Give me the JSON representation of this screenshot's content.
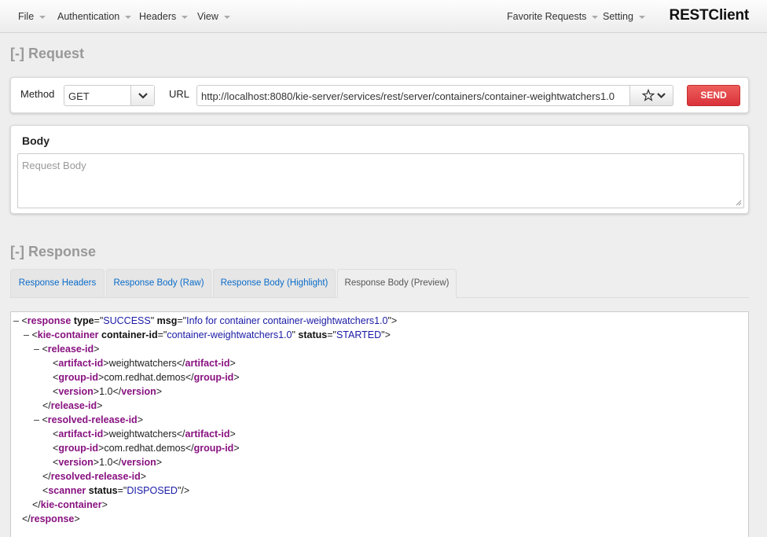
{
  "nav": {
    "file": "File",
    "authentication": "Authentication",
    "headers": "Headers",
    "view": "View",
    "favorite_requests": "Favorite Requests",
    "setting": "Setting",
    "brand": "RESTClient"
  },
  "request": {
    "section_title": "[-] Request",
    "method_label": "Method",
    "method_value": "GET",
    "url_label": "URL",
    "url_value": "http://localhost:8080/kie-server/services/rest/server/containers/container-weightwatchers1.0",
    "send_label": "SEND",
    "body_title": "Body",
    "body_placeholder": "Request Body"
  },
  "response": {
    "section_title": "[-] Response",
    "tabs": [
      {
        "label": "Response Headers"
      },
      {
        "label": "Response Body (Raw)"
      },
      {
        "label": "Response Body (Highlight)"
      },
      {
        "label": "Response Body (Preview)"
      }
    ],
    "xml": {
      "collapse_toggle": "–",
      "response_tag": "response",
      "response_type_attr": "type",
      "response_type_val": "SUCCESS",
      "response_msg_attr": "msg",
      "response_msg_val": "Info for container container-weightwatchers1.0",
      "container_tag": "kie-container",
      "container_id_attr": "container-id",
      "container_id_val": "container-weightwatchers1.0",
      "container_status_attr": "status",
      "container_status_val": "STARTED",
      "release_tag": "release-id",
      "artifact_tag": "artifact-id",
      "artifact_val": "weightwatchers",
      "group_tag": "group-id",
      "group_val": "com.redhat.demos",
      "version_tag": "version",
      "version_val": "1.0",
      "resolved_tag": "resolved-release-id",
      "scanner_tag": "scanner",
      "scanner_status_attr": "status",
      "scanner_status_val": "DISPOSED"
    }
  }
}
